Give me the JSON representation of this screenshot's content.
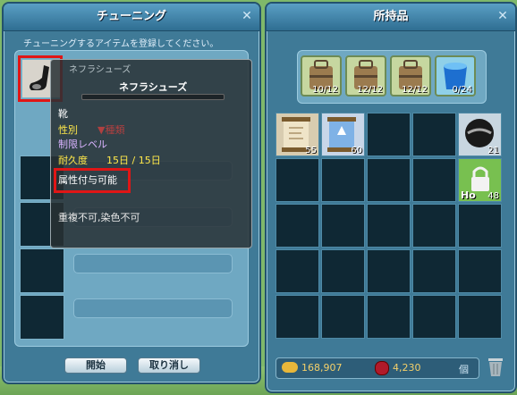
{
  "tuning": {
    "title": "チューニング",
    "instruction": "チューニングするアイテムを登録してください。",
    "start_label": "開始",
    "cancel_label": "取り消し"
  },
  "tooltip": {
    "header_name": "ネフラシューズ",
    "name": "ネフラシューズ",
    "category": "靴",
    "gender_label": "性別",
    "level_label": "制限レベル",
    "durability_label": "耐久度",
    "durability_value": "15日 / 15日",
    "attribute_text": "属性付与可能",
    "restriction_text": "重複不可,染色不可",
    "hidden_button_text": "▼種類"
  },
  "inventory": {
    "title": "所持品",
    "bags": [
      {
        "count": "10/12"
      },
      {
        "count": "12/12"
      },
      {
        "count": "12/12"
      },
      {
        "count": "0/24"
      }
    ],
    "items": [
      {
        "count": "55",
        "icon": "scroll-icon"
      },
      {
        "count": "60",
        "icon": "map-scroll-icon"
      },
      {
        "count": "21",
        "icon": "ball-icon"
      },
      {
        "count": "48",
        "icon": "lock-icon",
        "label": "Ho"
      }
    ],
    "gold": "168,907",
    "gems": "4,230",
    "gem_unit": "個"
  },
  "colors": {
    "accent_red": "#e01616",
    "yellow_text": "#ffe84a",
    "gold_text": "#f4d06a"
  }
}
